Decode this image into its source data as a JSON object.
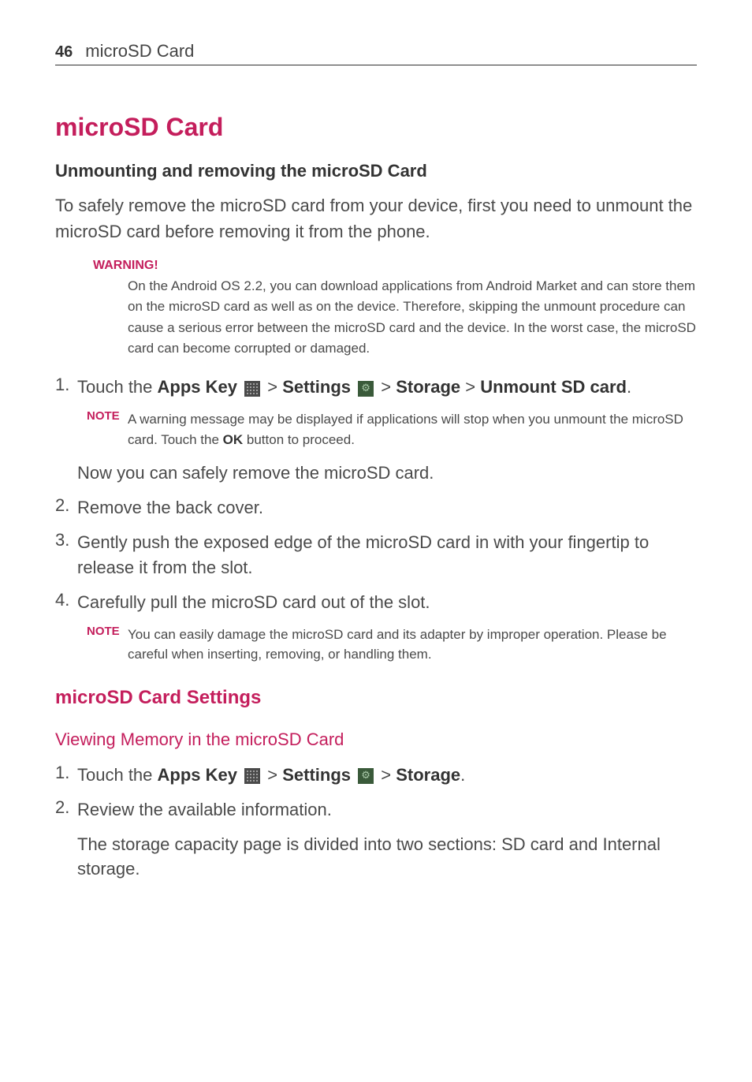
{
  "page": {
    "number": "46",
    "header_title": "microSD Card"
  },
  "main_title": "microSD Card",
  "subtitle": "Unmounting and removing the microSD Card",
  "intro": "To safely remove the microSD card from your device, first you need to unmount the microSD card before removing it from the phone.",
  "warning": {
    "label": "WARNING!",
    "text": "On the Android OS 2.2, you can download applications from Android Market and can store them on the microSD card as well as on the device. Therefore, skipping the unmount procedure can cause a serious error between the microSD card and the device. In the worst case, the microSD card can become corrupted or damaged."
  },
  "step1": {
    "num": "1.",
    "prefix": "Touch the ",
    "apps_key": "Apps Key",
    "gt1": " > ",
    "settings": "Settings",
    "gt2": " > ",
    "storage": "Storage",
    "gt3": " > ",
    "unmount": "Unmount SD card",
    "period": "."
  },
  "note1": {
    "label": "NOTE",
    "text_a": "A warning message may be displayed if applications will stop when you unmount the microSD card. Touch the ",
    "ok": "OK",
    "text_b": " button to proceed."
  },
  "step1_continuation": "Now you can safely remove the microSD card.",
  "step2": {
    "num": "2.",
    "text": "Remove the back cover."
  },
  "step3": {
    "num": "3.",
    "text": "Gently push the exposed edge of the microSD card in with your fingertip to release it from the slot."
  },
  "step4": {
    "num": "4.",
    "text": "Carefully pull the microSD card out of the slot."
  },
  "note2": {
    "label": "NOTE",
    "text": "You can easily damage the microSD card and its adapter by improper operation. Please be careful when inserting, removing, or handling them."
  },
  "section2_title": "microSD Card Settings",
  "sub_section_title": "Viewing Memory in the microSD Card",
  "s2_step1": {
    "num": "1.",
    "prefix": "Touch the ",
    "apps_key": "Apps Key",
    "gt1": " > ",
    "settings": "Settings",
    "gt2": " > ",
    "storage": "Storage",
    "period": "."
  },
  "s2_step2": {
    "num": "2.",
    "text": "Review the available information."
  },
  "s2_continuation": "The storage capacity page is divided into two sections: SD card and Internal storage."
}
